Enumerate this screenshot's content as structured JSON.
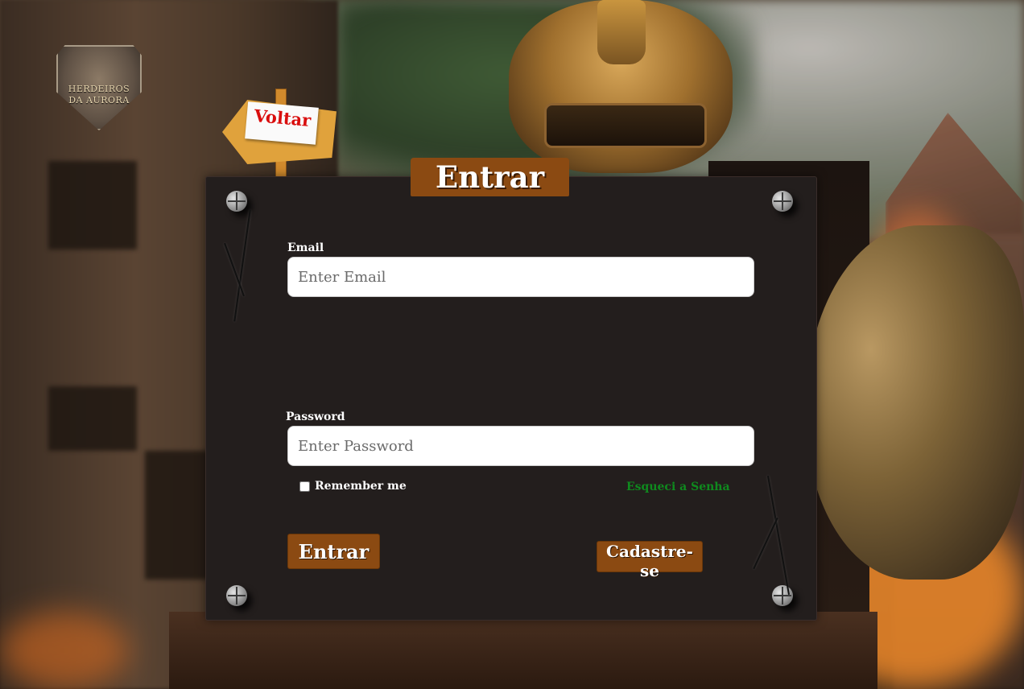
{
  "logo": {
    "line1": "HERDEIROS",
    "line2": "DA AURORA"
  },
  "back_button": {
    "label": "Voltar"
  },
  "card": {
    "title": "Entrar"
  },
  "form": {
    "email_label": "Email",
    "email_placeholder": "Enter Email",
    "password_label": "Password",
    "password_placeholder": "Enter Password",
    "remember_label": "Remember me",
    "forgot_label": "Esqueci a Senha",
    "login_label": "Entrar",
    "signup_label": "Cadastre-se"
  },
  "colors": {
    "accent": "#8b4a12",
    "card_bg": "#231e1d",
    "forgot_link": "#0f8a1e",
    "back_text": "#d90e0e"
  },
  "icons": [
    "screw-icon",
    "crack-decoration",
    "shield-logo-icon",
    "arrow-sign-icon"
  ]
}
